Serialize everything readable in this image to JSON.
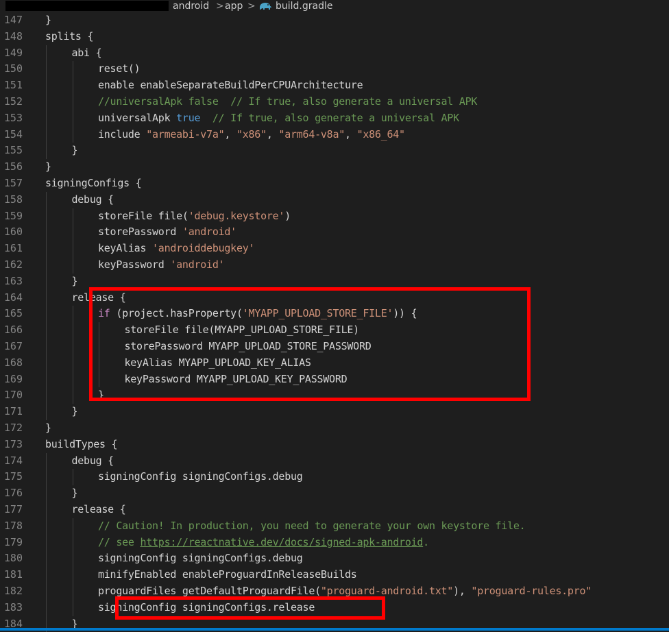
{
  "breadcrumb": {
    "items": [
      "android",
      "app",
      "build.gradle"
    ],
    "separator": ">"
  },
  "colors": {
    "background": "#1e1e1e",
    "keyword": "#569cd6",
    "control_keyword": "#c586c0",
    "string": "#ce9178",
    "comment": "#6a9955",
    "line_number": "#858585",
    "highlight_box": "#ff0000"
  },
  "lines": [
    {
      "n": "147",
      "indent": 1,
      "segments": [
        {
          "t": "p",
          "v": "}"
        }
      ]
    },
    {
      "n": "148",
      "indent": 1,
      "segments": [
        {
          "t": "p",
          "v": "splits {"
        }
      ]
    },
    {
      "n": "149",
      "indent": 2,
      "segments": [
        {
          "t": "p",
          "v": "abi {"
        }
      ]
    },
    {
      "n": "150",
      "indent": 3,
      "segments": [
        {
          "t": "p",
          "v": "reset()"
        }
      ]
    },
    {
      "n": "151",
      "indent": 3,
      "segments": [
        {
          "t": "p",
          "v": "enable enableSeparateBuildPerCPUArchitecture"
        }
      ]
    },
    {
      "n": "152",
      "indent": 3,
      "segments": [
        {
          "t": "c",
          "v": "//universalApk false  // If true, also generate a universal APK"
        }
      ]
    },
    {
      "n": "153",
      "indent": 3,
      "segments": [
        {
          "t": "p",
          "v": "universalApk "
        },
        {
          "t": "k",
          "v": "true"
        },
        {
          "t": "c",
          "v": "  // If true, also generate a universal APK"
        }
      ]
    },
    {
      "n": "154",
      "indent": 3,
      "segments": [
        {
          "t": "p",
          "v": "include "
        },
        {
          "t": "s",
          "v": "\"armeabi-v7a\""
        },
        {
          "t": "p",
          "v": ", "
        },
        {
          "t": "s",
          "v": "\"x86\""
        },
        {
          "t": "p",
          "v": ", "
        },
        {
          "t": "s",
          "v": "\"arm64-v8a\""
        },
        {
          "t": "p",
          "v": ", "
        },
        {
          "t": "s",
          "v": "\"x86_64\""
        }
      ]
    },
    {
      "n": "155",
      "indent": 2,
      "segments": [
        {
          "t": "p",
          "v": "}"
        }
      ]
    },
    {
      "n": "156",
      "indent": 1,
      "segments": [
        {
          "t": "p",
          "v": "}"
        }
      ]
    },
    {
      "n": "157",
      "indent": 1,
      "segments": [
        {
          "t": "p",
          "v": "signingConfigs {"
        }
      ]
    },
    {
      "n": "158",
      "indent": 2,
      "segments": [
        {
          "t": "p",
          "v": "debug {"
        }
      ]
    },
    {
      "n": "159",
      "indent": 3,
      "segments": [
        {
          "t": "p",
          "v": "storeFile file("
        },
        {
          "t": "s",
          "v": "'debug.keystore'"
        },
        {
          "t": "p",
          "v": ")"
        }
      ]
    },
    {
      "n": "160",
      "indent": 3,
      "segments": [
        {
          "t": "p",
          "v": "storePassword "
        },
        {
          "t": "s",
          "v": "'android'"
        }
      ]
    },
    {
      "n": "161",
      "indent": 3,
      "segments": [
        {
          "t": "p",
          "v": "keyAlias "
        },
        {
          "t": "s",
          "v": "'androiddebugkey'"
        }
      ]
    },
    {
      "n": "162",
      "indent": 3,
      "segments": [
        {
          "t": "p",
          "v": "keyPassword "
        },
        {
          "t": "s",
          "v": "'android'"
        }
      ]
    },
    {
      "n": "163",
      "indent": 2,
      "segments": [
        {
          "t": "p",
          "v": "}"
        }
      ]
    },
    {
      "n": "164",
      "indent": 2,
      "segments": [
        {
          "t": "p",
          "v": "release {"
        }
      ]
    },
    {
      "n": "165",
      "indent": 3,
      "segments": [
        {
          "t": "k2",
          "v": "if"
        },
        {
          "t": "p",
          "v": " (project.hasProperty("
        },
        {
          "t": "s",
          "v": "'MYAPP_UPLOAD_STORE_FILE'"
        },
        {
          "t": "p",
          "v": ")) {"
        }
      ]
    },
    {
      "n": "166",
      "indent": 4,
      "segments": [
        {
          "t": "p",
          "v": "storeFile file(MYAPP_UPLOAD_STORE_FILE)"
        }
      ]
    },
    {
      "n": "167",
      "indent": 4,
      "segments": [
        {
          "t": "p",
          "v": "storePassword MYAPP_UPLOAD_STORE_PASSWORD"
        }
      ]
    },
    {
      "n": "168",
      "indent": 4,
      "segments": [
        {
          "t": "p",
          "v": "keyAlias MYAPP_UPLOAD_KEY_ALIAS"
        }
      ]
    },
    {
      "n": "169",
      "indent": 4,
      "segments": [
        {
          "t": "p",
          "v": "keyPassword MYAPP_UPLOAD_KEY_PASSWORD"
        }
      ]
    },
    {
      "n": "170",
      "indent": 3,
      "segments": [
        {
          "t": "p",
          "v": "}"
        }
      ]
    },
    {
      "n": "171",
      "indent": 2,
      "segments": [
        {
          "t": "p",
          "v": "}"
        }
      ]
    },
    {
      "n": "172",
      "indent": 1,
      "segments": [
        {
          "t": "p",
          "v": "}"
        }
      ]
    },
    {
      "n": "173",
      "indent": 1,
      "segments": [
        {
          "t": "p",
          "v": "buildTypes {"
        }
      ]
    },
    {
      "n": "174",
      "indent": 2,
      "segments": [
        {
          "t": "p",
          "v": "debug {"
        }
      ]
    },
    {
      "n": "175",
      "indent": 3,
      "segments": [
        {
          "t": "p",
          "v": "signingConfig signingConfigs.debug"
        }
      ]
    },
    {
      "n": "176",
      "indent": 2,
      "segments": [
        {
          "t": "p",
          "v": "}"
        }
      ]
    },
    {
      "n": "177",
      "indent": 2,
      "segments": [
        {
          "t": "p",
          "v": "release {"
        }
      ]
    },
    {
      "n": "178",
      "indent": 3,
      "segments": [
        {
          "t": "c",
          "v": "// Caution! In production, you need to generate your own keystore file."
        }
      ]
    },
    {
      "n": "179",
      "indent": 3,
      "segments": [
        {
          "t": "c",
          "v": "// see "
        },
        {
          "t": "u",
          "v": "https://reactnative.dev/docs/signed-apk-android"
        },
        {
          "t": "c",
          "v": "."
        }
      ]
    },
    {
      "n": "180",
      "indent": 3,
      "segments": [
        {
          "t": "p",
          "v": "signingConfig signingConfigs.debug"
        }
      ]
    },
    {
      "n": "181",
      "indent": 3,
      "segments": [
        {
          "t": "p",
          "v": "minifyEnabled enableProguardInReleaseBuilds"
        }
      ]
    },
    {
      "n": "182",
      "indent": 3,
      "segments": [
        {
          "t": "p",
          "v": "proguardFiles getDefaultProguardFile("
        },
        {
          "t": "s",
          "v": "\"proguard-android.txt\""
        },
        {
          "t": "p",
          "v": "), "
        },
        {
          "t": "s",
          "v": "\"proguard-rules.pro\""
        }
      ]
    },
    {
      "n": "183",
      "indent": 3,
      "segments": [
        {
          "t": "p",
          "v": "signingConfig signingConfigs.release"
        }
      ]
    },
    {
      "n": "184",
      "indent": 2,
      "segments": [
        {
          "t": "p",
          "v": "}"
        }
      ]
    }
  ]
}
